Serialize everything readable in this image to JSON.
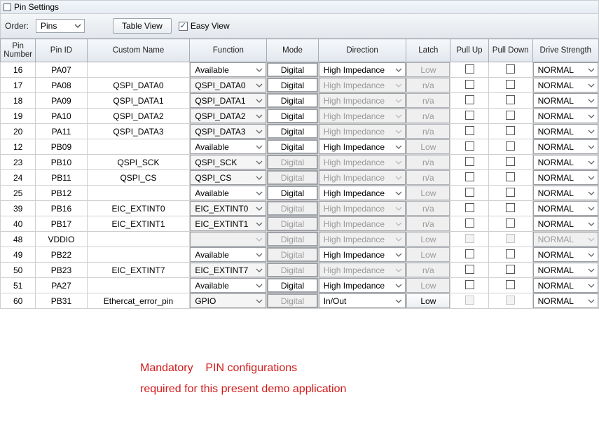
{
  "window": {
    "title": "Pin Settings"
  },
  "toolbar": {
    "order_label": "Order:",
    "order_value": "Pins",
    "table_view_btn": "Table View",
    "easy_view_label": "Easy View",
    "easy_view_checked": true
  },
  "headers": {
    "pin_number": "Pin\nNumber",
    "pin_id": "Pin ID",
    "custom_name": "Custom Name",
    "function": "Function",
    "mode": "Mode",
    "direction": "Direction",
    "latch": "Latch",
    "pull_up": "Pull Up",
    "pull_down": "Pull Down",
    "drive_strength": "Drive Strength"
  },
  "rows": [
    {
      "num": "16",
      "id": "PA07",
      "custom": "",
      "func": "Available",
      "func_en": true,
      "mode": "Digital",
      "mode_en": true,
      "dir": "High Impedance",
      "dir_en": true,
      "latch": "Low",
      "latch_en": false,
      "pu_en": true,
      "pd_en": true,
      "drive": "NORMAL",
      "drive_en": true
    },
    {
      "num": "17",
      "id": "PA08",
      "custom": "QSPI_DATA0",
      "func": "QSPI_DATA0",
      "func_en": true,
      "mode": "Digital",
      "mode_en": true,
      "dir": "High Impedance",
      "dir_en": false,
      "latch": "n/a",
      "latch_en": false,
      "pu_en": true,
      "pd_en": true,
      "drive": "NORMAL",
      "drive_en": true
    },
    {
      "num": "18",
      "id": "PA09",
      "custom": "QSPI_DATA1",
      "func": "QSPI_DATA1",
      "func_en": true,
      "mode": "Digital",
      "mode_en": true,
      "dir": "High Impedance",
      "dir_en": false,
      "latch": "n/a",
      "latch_en": false,
      "pu_en": true,
      "pd_en": true,
      "drive": "NORMAL",
      "drive_en": true
    },
    {
      "num": "19",
      "id": "PA10",
      "custom": "QSPI_DATA2",
      "func": "QSPI_DATA2",
      "func_en": true,
      "mode": "Digital",
      "mode_en": true,
      "dir": "High Impedance",
      "dir_en": false,
      "latch": "n/a",
      "latch_en": false,
      "pu_en": true,
      "pd_en": true,
      "drive": "NORMAL",
      "drive_en": true
    },
    {
      "num": "20",
      "id": "PA11",
      "custom": "QSPI_DATA3",
      "func": "QSPI_DATA3",
      "func_en": true,
      "mode": "Digital",
      "mode_en": true,
      "dir": "High Impedance",
      "dir_en": false,
      "latch": "n/a",
      "latch_en": false,
      "pu_en": true,
      "pd_en": true,
      "drive": "NORMAL",
      "drive_en": true
    },
    {
      "num": "12",
      "id": "PB09",
      "custom": "",
      "func": "Available",
      "func_en": true,
      "mode": "Digital",
      "mode_en": true,
      "dir": "High Impedance",
      "dir_en": true,
      "latch": "Low",
      "latch_en": false,
      "pu_en": true,
      "pd_en": true,
      "drive": "NORMAL",
      "drive_en": true
    },
    {
      "num": "23",
      "id": "PB10",
      "custom": "QSPI_SCK",
      "func": "QSPI_SCK",
      "func_en": true,
      "mode": "Digital",
      "mode_en": false,
      "dir": "High Impedance",
      "dir_en": false,
      "latch": "n/a",
      "latch_en": false,
      "pu_en": true,
      "pd_en": true,
      "drive": "NORMAL",
      "drive_en": true
    },
    {
      "num": "24",
      "id": "PB11",
      "custom": "QSPI_CS",
      "func": "QSPI_CS",
      "func_en": true,
      "mode": "Digital",
      "mode_en": false,
      "dir": "High Impedance",
      "dir_en": false,
      "latch": "n/a",
      "latch_en": false,
      "pu_en": true,
      "pd_en": true,
      "drive": "NORMAL",
      "drive_en": true
    },
    {
      "num": "25",
      "id": "PB12",
      "custom": "",
      "func": "Available",
      "func_en": true,
      "mode": "Digital",
      "mode_en": true,
      "dir": "High Impedance",
      "dir_en": true,
      "latch": "Low",
      "latch_en": false,
      "pu_en": true,
      "pd_en": true,
      "drive": "NORMAL",
      "drive_en": true
    },
    {
      "num": "39",
      "id": "PB16",
      "custom": "EIC_EXTINT0",
      "func": "EIC_EXTINT0",
      "func_en": true,
      "mode": "Digital",
      "mode_en": false,
      "dir": "High Impedance",
      "dir_en": false,
      "latch": "n/a",
      "latch_en": false,
      "pu_en": true,
      "pd_en": true,
      "drive": "NORMAL",
      "drive_en": true
    },
    {
      "num": "40",
      "id": "PB17",
      "custom": "EIC_EXTINT1",
      "func": "EIC_EXTINT1",
      "func_en": true,
      "mode": "Digital",
      "mode_en": false,
      "dir": "High Impedance",
      "dir_en": false,
      "latch": "n/a",
      "latch_en": false,
      "pu_en": true,
      "pd_en": true,
      "drive": "NORMAL",
      "drive_en": true
    },
    {
      "num": "48",
      "id": "VDDIO",
      "custom": "",
      "func": "",
      "func_en": false,
      "mode": "Digital",
      "mode_en": false,
      "dir": "High Impedance",
      "dir_en": false,
      "latch": "Low",
      "latch_en": false,
      "pu_en": false,
      "pd_en": false,
      "drive": "NORMAL",
      "drive_en": false
    },
    {
      "num": "49",
      "id": "PB22",
      "custom": "",
      "func": "Available",
      "func_en": true,
      "mode": "Digital",
      "mode_en": false,
      "dir": "High Impedance",
      "dir_en": true,
      "latch": "Low",
      "latch_en": false,
      "pu_en": true,
      "pd_en": true,
      "drive": "NORMAL",
      "drive_en": true
    },
    {
      "num": "50",
      "id": "PB23",
      "custom": "EIC_EXTINT7",
      "func": "EIC_EXTINT7",
      "func_en": true,
      "mode": "Digital",
      "mode_en": false,
      "dir": "High Impedance",
      "dir_en": false,
      "latch": "n/a",
      "latch_en": false,
      "pu_en": true,
      "pd_en": true,
      "drive": "NORMAL",
      "drive_en": true
    },
    {
      "num": "51",
      "id": "PA27",
      "custom": "",
      "func": "Available",
      "func_en": true,
      "mode": "Digital",
      "mode_en": true,
      "dir": "High Impedance",
      "dir_en": true,
      "latch": "Low",
      "latch_en": false,
      "pu_en": true,
      "pd_en": true,
      "drive": "NORMAL",
      "drive_en": true
    },
    {
      "num": "60",
      "id": "PB31",
      "custom": "Ethercat_error_pin",
      "func": "GPIO",
      "func_en": true,
      "mode": "Digital",
      "mode_en": false,
      "dir": "In/Out",
      "dir_en": true,
      "latch": "Low",
      "latch_en": true,
      "pu_en": false,
      "pd_en": false,
      "drive": "NORMAL",
      "drive_en": true
    }
  ],
  "note": {
    "line1": "Mandatory    PIN configurations",
    "line2": "required for this present demo application"
  }
}
